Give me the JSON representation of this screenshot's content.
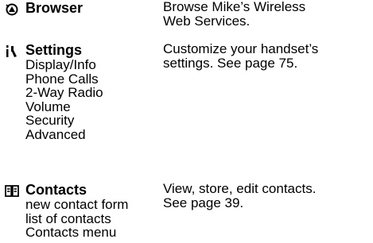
{
  "entries": [
    {
      "title": "Browser",
      "icon": "browser-icon",
      "subitems": [],
      "description": [
        "Browse Mike’s Wireless",
        "Web Services."
      ]
    },
    {
      "title": "Settings",
      "icon": "settings-icon",
      "subitems": [
        "Display/Info",
        "Phone Calls",
        "2-Way Radio",
        "Volume",
        "Security",
        "Advanced"
      ],
      "description": [
        "Customize your handset’s",
        "settings. See page 75."
      ]
    },
    {
      "title": "Contacts",
      "icon": "contacts-book-icon",
      "subitems": [
        "new contact form",
        "list of contacts",
        "Contacts menu"
      ],
      "description": [
        "View, store, edit contacts.",
        "See page 39."
      ]
    }
  ]
}
